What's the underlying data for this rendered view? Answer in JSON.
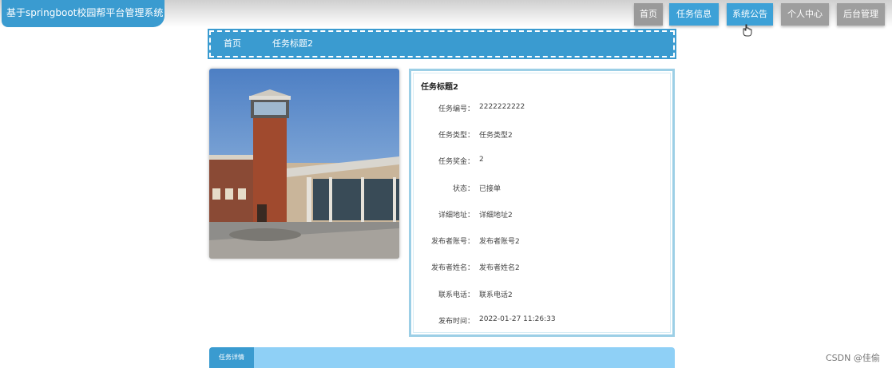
{
  "header": {
    "brand": "基于springboot校园帮平台管理系统",
    "nav": [
      "首页",
      "任务信息",
      "系统公告",
      "个人中心",
      "后台管理"
    ]
  },
  "breadcrumb": {
    "home": "首页",
    "current": "任务标题2"
  },
  "detail": {
    "title": "任务标题2",
    "fields": [
      {
        "label": "任务编号：",
        "value": "2222222222"
      },
      {
        "label": "任务类型：",
        "value": "任务类型2"
      },
      {
        "label": "任务奖金：",
        "value": "2"
      },
      {
        "label": "状态：",
        "value": "已接单"
      },
      {
        "label": "详细地址：",
        "value": "详细地址2"
      },
      {
        "label": "发布者账号：",
        "value": "发布者账号2"
      },
      {
        "label": "发布者姓名：",
        "value": "发布者姓名2"
      },
      {
        "label": "联系电话：",
        "value": "联系电话2"
      },
      {
        "label": "发布时间：",
        "value": "2022-01-27 11:26:33"
      }
    ]
  },
  "bottom": {
    "tab": "任务详情"
  },
  "watermark": "CSDN @佳偷",
  "colors": {
    "primary": "#3a9bd0",
    "light": "#8fd0f6",
    "border": "#9ccfe6"
  }
}
